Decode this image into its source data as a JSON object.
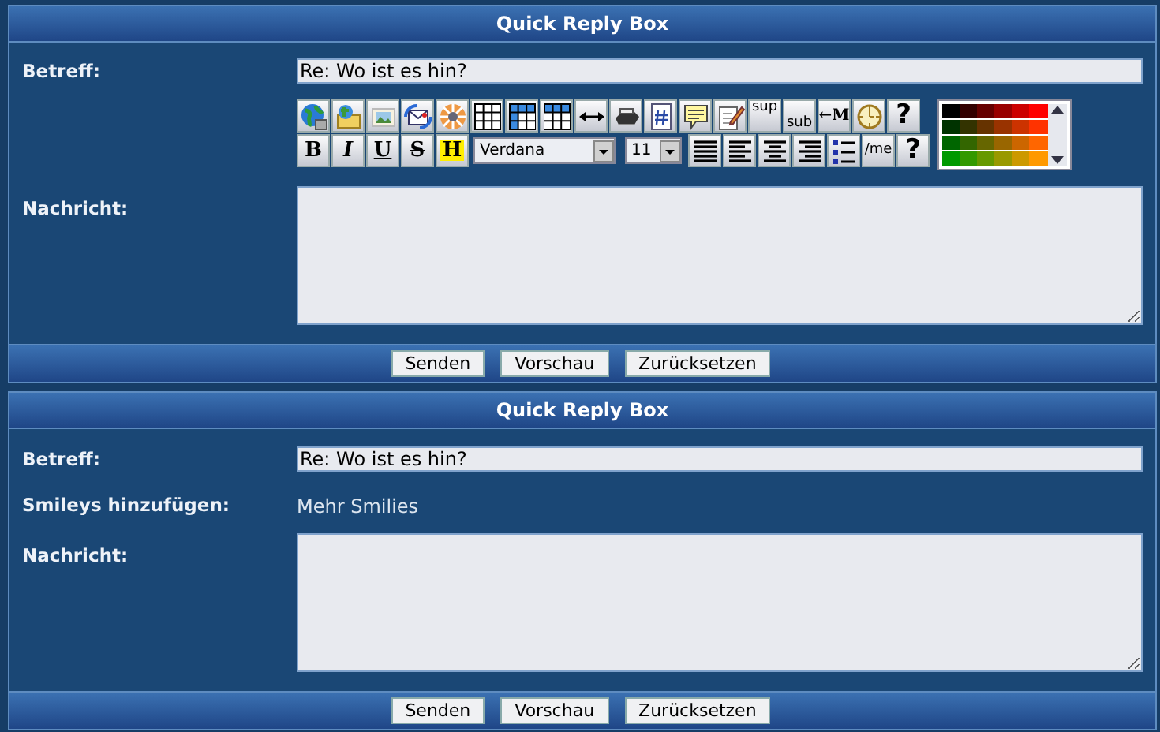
{
  "panels": [
    {
      "title": "Quick Reply Box",
      "fields": [
        {
          "kind": "input",
          "label": "Betreff:",
          "value": "Re: Wo ist es hin?"
        },
        {
          "kind": "toolbar",
          "rows": [
            [
              {
                "kind": "icon"
              },
              {
                "kind": "icon"
              },
              {
                "kind": "icon"
              },
              {
                "kind": "icon"
              },
              {
                "kind": "icon"
              },
              {
                "kind": "icon"
              },
              {
                "kind": "icon"
              },
              {
                "kind": "icon"
              },
              {
                "kind": "icon"
              },
              {
                "kind": "icon"
              },
              {
                "kind": "icon"
              },
              {
                "kind": "icon"
              },
              {
                "kind": "icon"
              },
              {
                "kind": "text",
                "label": "sup"
              },
              {
                "kind": "text",
                "label": "sub"
              },
              {
                "kind": "text",
                "label": "←M"
              },
              {
                "kind": "icon"
              },
              {
                "kind": "text",
                "label": "?"
              }
            ],
            [
              {
                "kind": "text",
                "label": "B"
              },
              {
                "kind": "text",
                "label": "I"
              },
              {
                "kind": "text",
                "label": "U"
              },
              {
                "kind": "text",
                "label": "S"
              },
              {
                "kind": "text",
                "label": "H"
              },
              {
                "kind": "select",
                "value": "Verdana"
              },
              {
                "kind": "select",
                "value": "11"
              },
              {
                "kind": "icon"
              },
              {
                "kind": "icon"
              },
              {
                "kind": "icon"
              },
              {
                "kind": "icon"
              },
              {
                "kind": "icon"
              },
              {
                "kind": "text",
                "label": "/me"
              },
              {
                "kind": "text",
                "label": "?"
              }
            ]
          ],
          "palette": [
            {
              "color": "#000000"
            },
            {
              "color": "#330000"
            },
            {
              "color": "#660000"
            },
            {
              "color": "#990000"
            },
            {
              "color": "#cc0000"
            },
            {
              "color": "#ff0000"
            },
            {
              "color": "#003300"
            },
            {
              "color": "#333300"
            },
            {
              "color": "#663300"
            },
            {
              "color": "#993300"
            },
            {
              "color": "#cc3300"
            },
            {
              "color": "#ff3300"
            },
            {
              "color": "#006600"
            },
            {
              "color": "#336600"
            },
            {
              "color": "#666600"
            },
            {
              "color": "#996600"
            },
            {
              "color": "#cc6600"
            },
            {
              "color": "#ff6600"
            },
            {
              "color": "#009900"
            },
            {
              "color": "#339900"
            },
            {
              "color": "#669900"
            },
            {
              "color": "#999900"
            },
            {
              "color": "#cc9900"
            },
            {
              "color": "#ff9900"
            }
          ]
        },
        {
          "kind": "textarea",
          "label": "Nachricht:"
        }
      ],
      "buttons": [
        "Senden",
        "Vorschau",
        "Zurücksetzen"
      ]
    },
    {
      "title": "Quick Reply Box",
      "fields": [
        {
          "kind": "input",
          "label": "Betreff:",
          "value": "Re: Wo ist es hin?"
        },
        {
          "kind": "link",
          "label": "Smileys hinzufügen:",
          "text": "Mehr Smilies"
        },
        {
          "kind": "textarea",
          "label": "Nachricht:"
        }
      ],
      "buttons": [
        "Senden",
        "Vorschau",
        "Zurücksetzen"
      ]
    }
  ]
}
